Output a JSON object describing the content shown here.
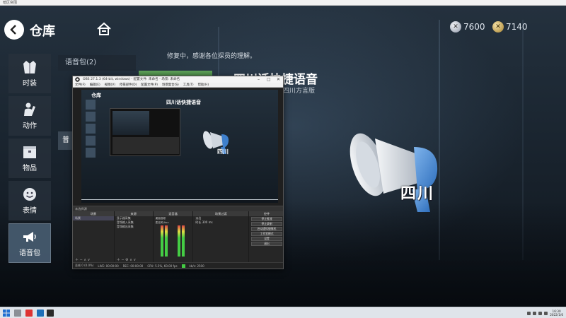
{
  "window": {
    "title": "暗区突围"
  },
  "header": {
    "title": "仓库",
    "back_icon": "back-arrow-icon",
    "home_icon": "home-icon"
  },
  "currency": [
    {
      "icon": "silver-coin-icon",
      "value": "7600"
    },
    {
      "icon": "gold-coin-icon",
      "value": "7140"
    }
  ],
  "nav": [
    {
      "label": "时装",
      "icon": "suit-icon"
    },
    {
      "label": "动作",
      "icon": "gesture-icon"
    },
    {
      "label": "物品",
      "icon": "box-icon"
    },
    {
      "label": "表情",
      "icon": "smile-icon"
    },
    {
      "label": "语音包",
      "icon": "megaphone-icon",
      "active": true
    }
  ],
  "category": {
    "header": "语音包(2)",
    "item_label": "普"
  },
  "notice": "修复中，感谢各位探员的理解。",
  "item": {
    "name": "四川话快捷语音",
    "subtitle": "四川方言版",
    "badge": "四川"
  },
  "obs": {
    "title": "OBS 27.1.3 (64-bit, windows) - 配置文件: 未命名 - 场景: 未命名",
    "menu": [
      "文件(F)",
      "编辑(E)",
      "视图(V)",
      "停靠部件(D)",
      "配置文件(P)",
      "场景集合(S)",
      "工具(T)",
      "帮助(H)"
    ],
    "preview": {
      "title": "仓库",
      "name": "四川话快捷语音",
      "badge": "四川"
    },
    "scene_bar": "未选择源",
    "docks": [
      {
        "title": "场景",
        "rows": [
          "场景"
        ]
      },
      {
        "title": "来源",
        "rows": [
          "显示器采集",
          "音频输入采集",
          "音频输出采集"
        ]
      },
      {
        "title": "混音器",
        "rows": [
          "桌面音频",
          "麦克风/Aux"
        ]
      },
      {
        "title": "场景过渡",
        "rows": [
          "淡出",
          "时长 300 ms"
        ]
      },
      {
        "title": "控件",
        "buttons": [
          "停止推流",
          "停止录制",
          "启动虚拟摄像机",
          "工作室模式",
          "设置",
          "退出"
        ]
      }
    ],
    "status": [
      "丢帧 0 (0.0%)",
      "LIVE: 00:00:00",
      "REC: 00:00:00",
      "CPU: 5.5%, 60.00 fps",
      "kb/s: 2500"
    ]
  },
  "taskbar": {
    "time": "16:30",
    "date": "2022/1/6"
  }
}
